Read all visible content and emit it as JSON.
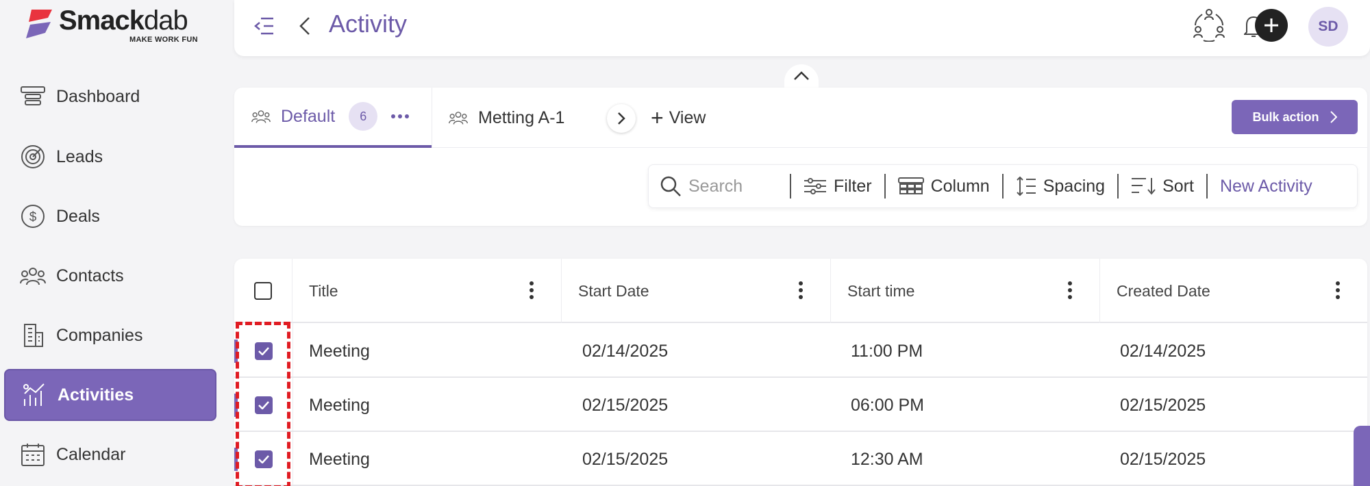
{
  "brand": {
    "name_bold": "Smack",
    "name_light": "dab",
    "tagline": "MAKE WORK FUN"
  },
  "sidebar": {
    "items": [
      {
        "label": "Dashboard",
        "icon": "dashboard-icon",
        "active": false
      },
      {
        "label": "Leads",
        "icon": "target-icon",
        "active": false
      },
      {
        "label": "Deals",
        "icon": "dollar-circle-icon",
        "active": false
      },
      {
        "label": "Contacts",
        "icon": "people-icon",
        "active": false
      },
      {
        "label": "Companies",
        "icon": "building-icon",
        "active": false
      },
      {
        "label": "Activities",
        "icon": "activity-chart-icon",
        "active": true
      },
      {
        "label": "Calendar",
        "icon": "calendar-icon",
        "active": false
      }
    ]
  },
  "header": {
    "title": "Activity",
    "avatar_initials": "SD"
  },
  "views": {
    "tabs": [
      {
        "label": "Default",
        "count": "6"
      },
      {
        "label": "Metting A-1"
      }
    ],
    "add_view_label": "View",
    "bulk_action_label": "Bulk action"
  },
  "toolbar": {
    "search_placeholder": "Search",
    "filter_label": "Filter",
    "column_label": "Column",
    "spacing_label": "Spacing",
    "sort_label": "Sort",
    "new_activity_label": "New Activity"
  },
  "table": {
    "columns": [
      "Title",
      "Start Date",
      "Start time",
      "Created Date"
    ],
    "rows": [
      {
        "title": "Meeting",
        "start_date": "02/14/2025",
        "start_time": "11:00 PM",
        "created_date": "02/14/2025",
        "checked": true
      },
      {
        "title": "Meeting",
        "start_date": "02/15/2025",
        "start_time": "06:00 PM",
        "created_date": "02/15/2025",
        "checked": true
      },
      {
        "title": "Meeting",
        "start_date": "02/15/2025",
        "start_time": "12:30 AM",
        "created_date": "02/15/2025",
        "checked": true
      }
    ]
  },
  "colors": {
    "accent": "#7b66b8",
    "accent_text": "#6c5aa8",
    "highlight": "#e01b22"
  }
}
